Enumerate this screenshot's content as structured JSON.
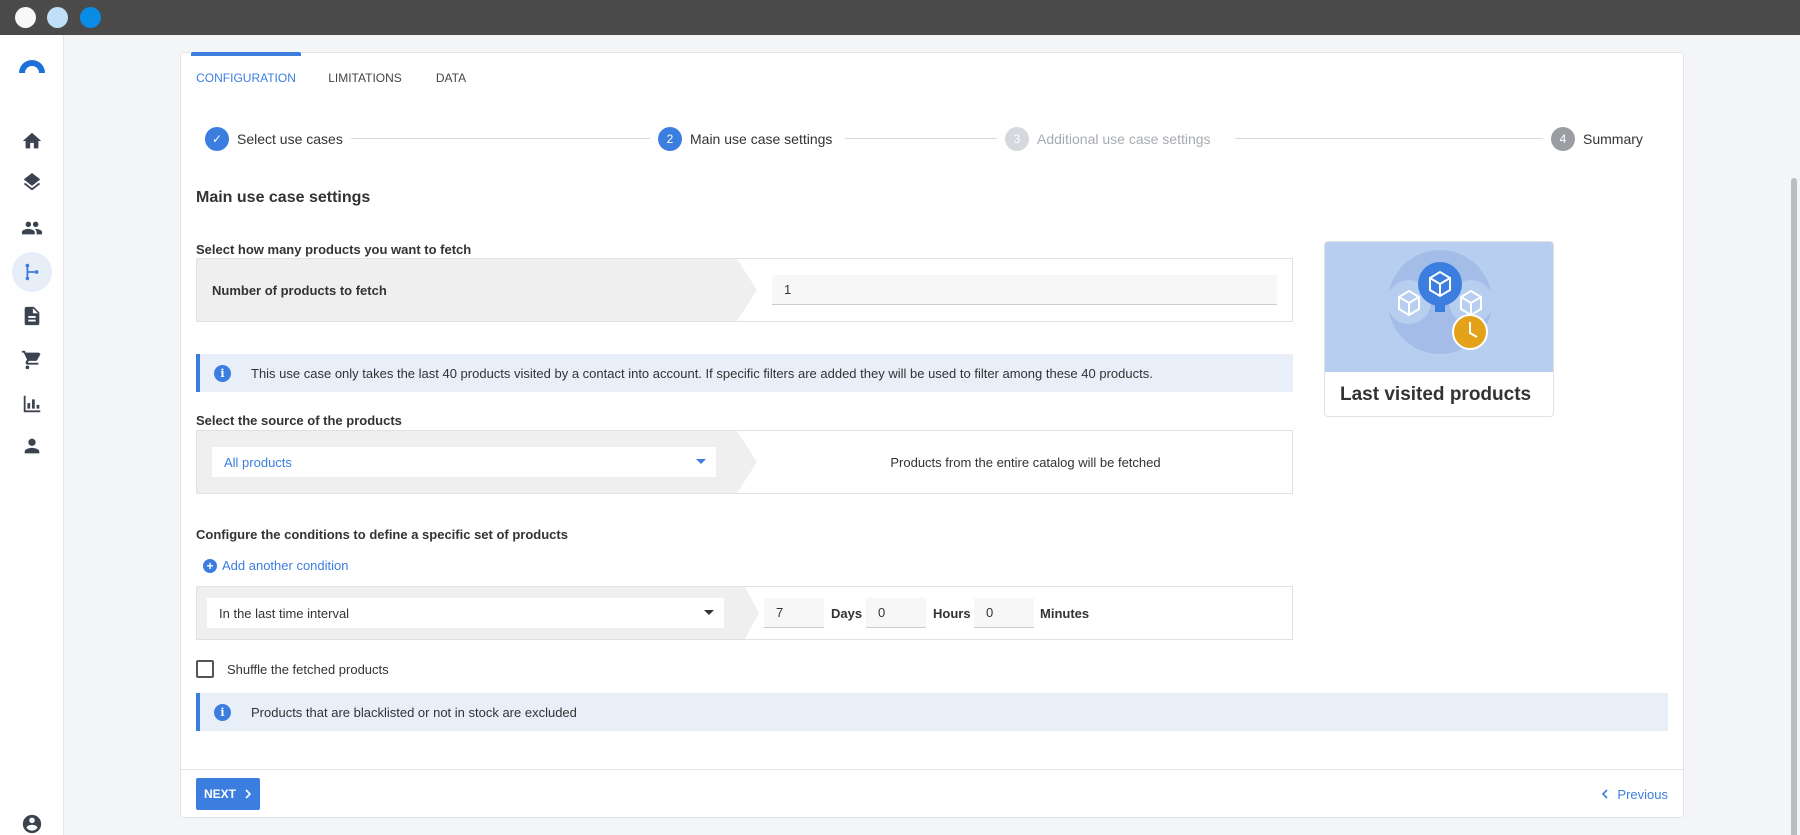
{
  "window": {
    "controls": [
      "close",
      "minimize",
      "maximize"
    ]
  },
  "sidebar": {
    "items": [
      {
        "icon": "home-icon"
      },
      {
        "icon": "layers-icon"
      },
      {
        "icon": "people-icon"
      },
      {
        "icon": "flow-icon",
        "active": true
      },
      {
        "icon": "document-icon"
      },
      {
        "icon": "cart-icon"
      },
      {
        "icon": "bar-chart-icon"
      },
      {
        "icon": "person-icon"
      },
      {
        "icon": "account-circle-icon"
      }
    ]
  },
  "tabs": [
    {
      "label": "CONFIGURATION",
      "active": true
    },
    {
      "label": "LIMITATIONS"
    },
    {
      "label": "DATA"
    }
  ],
  "stepper": {
    "steps": [
      {
        "number": "✓",
        "label": "Select use cases",
        "state": "done"
      },
      {
        "number": "2",
        "label": "Main use case settings",
        "state": "current"
      },
      {
        "number": "3",
        "label": "Additional use case settings",
        "state": "pending"
      },
      {
        "number": "4",
        "label": "Summary",
        "state": "upcoming"
      }
    ]
  },
  "main": {
    "section_title": "Main use case settings",
    "fetch": {
      "question": "Select how many products you want to fetch",
      "field_label": "Number of products to fetch",
      "value": "1"
    },
    "info_1": "This use case only takes the last 40 products visited by a contact into account. If specific filters are added they will be used to filter among these 40 products.",
    "source": {
      "question": "Select the source of the products",
      "selected": "All products",
      "description": "Products from the entire catalog will be fetched"
    },
    "conditions": {
      "question": "Configure the conditions to define a specific set of products",
      "add_label": "Add another condition",
      "interval_selected": "In the last time interval",
      "days_value": "7",
      "days_label": "Days",
      "hours_value": "0",
      "hours_label": "Hours",
      "minutes_value": "0",
      "minutes_label": "Minutes"
    },
    "shuffle_label": "Shuffle the fetched products",
    "shuffle_checked": false,
    "info_2": "Products that are blacklisted or not in stock are excluded"
  },
  "preview": {
    "title": "Last visited products"
  },
  "footer": {
    "next_label": "NEXT",
    "previous_label": "Previous"
  },
  "colors": {
    "accent": "#3c7de0",
    "info_bg": "#e8eff9",
    "clock": "#e3a21a"
  }
}
